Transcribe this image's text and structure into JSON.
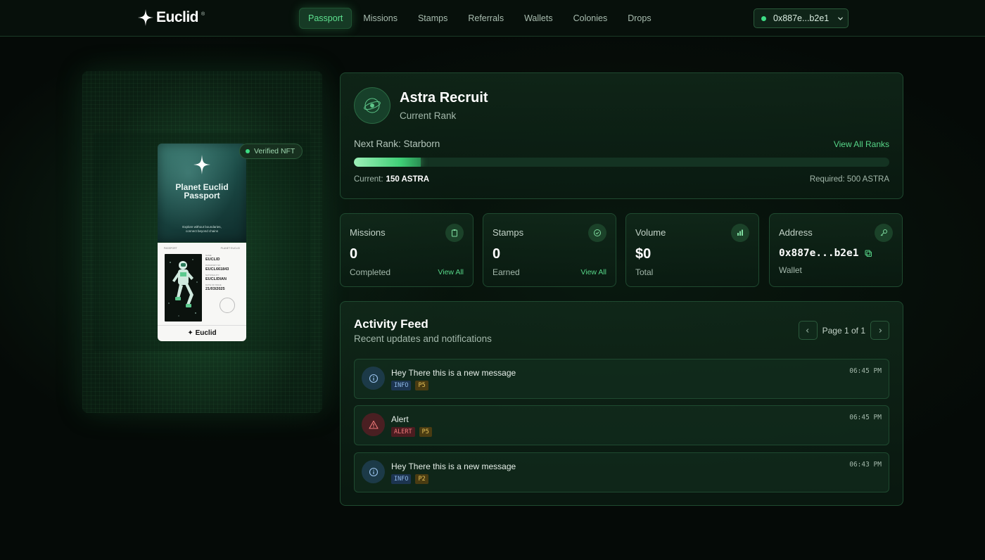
{
  "header": {
    "logo_text": "Euclid",
    "logo_tm": "®",
    "nav": [
      {
        "label": "Passport",
        "active": true
      },
      {
        "label": "Missions"
      },
      {
        "label": "Stamps"
      },
      {
        "label": "Referrals"
      },
      {
        "label": "Wallets"
      },
      {
        "label": "Colonies"
      },
      {
        "label": "Drops"
      }
    ],
    "wallet": "0x887e...b2e1"
  },
  "passport": {
    "badge": "Verified NFT",
    "card_title_1": "Planet Euclid",
    "card_title_2": "Passport",
    "motto_1": "Explore without boundaries,",
    "motto_2": "connect beyond chains",
    "head_left": "PASSPORT",
    "head_right": "PLANET EUCLID",
    "fields": [
      {
        "label": "NAME",
        "value": "EUCLID"
      },
      {
        "label": "PASSPORT NO",
        "value": "EUCL661843"
      },
      {
        "label": "NATIONALITY",
        "value": "EUCLIDIAN"
      },
      {
        "label": "DATE OF ISSUE",
        "value": "21/03/2025"
      }
    ],
    "footer_logo": "Euclid"
  },
  "rank": {
    "title": "Astra Recruit",
    "subtitle": "Current Rank",
    "next_rank": "Next Rank: Starborn",
    "view_all": "View All Ranks",
    "current_label": "Current:",
    "current_value": "150 ASTRA",
    "required": "Required: 500 ASTRA",
    "progress": 0.125
  },
  "stats": [
    {
      "label": "Missions",
      "value": "0",
      "sub": "Completed",
      "link": "View All",
      "icon": "clipboard-icon"
    },
    {
      "label": "Stamps",
      "value": "0",
      "sub": "Earned",
      "link": "View All",
      "icon": "check-circle-icon"
    },
    {
      "label": "Volume",
      "value": "$0",
      "sub": "Total",
      "icon": "bar-chart-icon"
    },
    {
      "label": "Address",
      "value": "0x887e...b2e1",
      "sub": "Wallet",
      "icon": "key-icon"
    }
  ],
  "feed": {
    "title": "Activity Feed",
    "subtitle": "Recent updates and notifications",
    "page": "Page 1 of 1",
    "items": [
      {
        "message": "Hey There this is a new message",
        "type": "INFO",
        "priority": "P5",
        "time": "06:45 PM"
      },
      {
        "message": "Alert",
        "type": "ALERT",
        "priority": "P5",
        "time": "06:45 PM"
      },
      {
        "message": "Hey There this is a new message",
        "type": "INFO",
        "priority": "P2",
        "time": "06:43 PM"
      }
    ]
  },
  "colors": {
    "accent": "#57d688",
    "background": "#050a07",
    "info": "#8fb9e8",
    "alert": "#f07a7a",
    "priority": "#e6c258"
  }
}
